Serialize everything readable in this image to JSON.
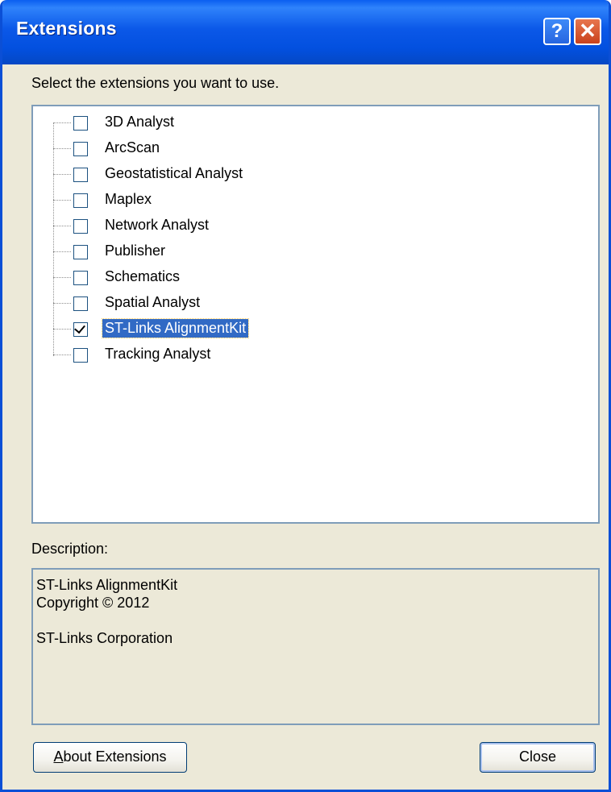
{
  "window": {
    "title": "Extensions"
  },
  "titlebar": {
    "help_glyph": "?",
    "close_glyph": "✕"
  },
  "prompt": "Select the extensions you want to use.",
  "extensions": [
    {
      "label": "3D Analyst",
      "checked": false
    },
    {
      "label": "ArcScan",
      "checked": false
    },
    {
      "label": "Geostatistical Analyst",
      "checked": false
    },
    {
      "label": "Maplex",
      "checked": false
    },
    {
      "label": "Network Analyst",
      "checked": false
    },
    {
      "label": "Publisher",
      "checked": false
    },
    {
      "label": "Schematics",
      "checked": false
    },
    {
      "label": "Spatial Analyst",
      "checked": false
    },
    {
      "label": "ST-Links AlignmentKit",
      "checked": true,
      "selected": true
    },
    {
      "label": "Tracking Analyst",
      "checked": false
    }
  ],
  "description": {
    "label": "Description:",
    "lines": [
      "ST-Links AlignmentKit",
      "Copyright © 2012",
      "",
      "ST-Links Corporation"
    ]
  },
  "buttons": {
    "about_prefix": "A",
    "about_rest": "bout Extensions",
    "close": "Close"
  }
}
